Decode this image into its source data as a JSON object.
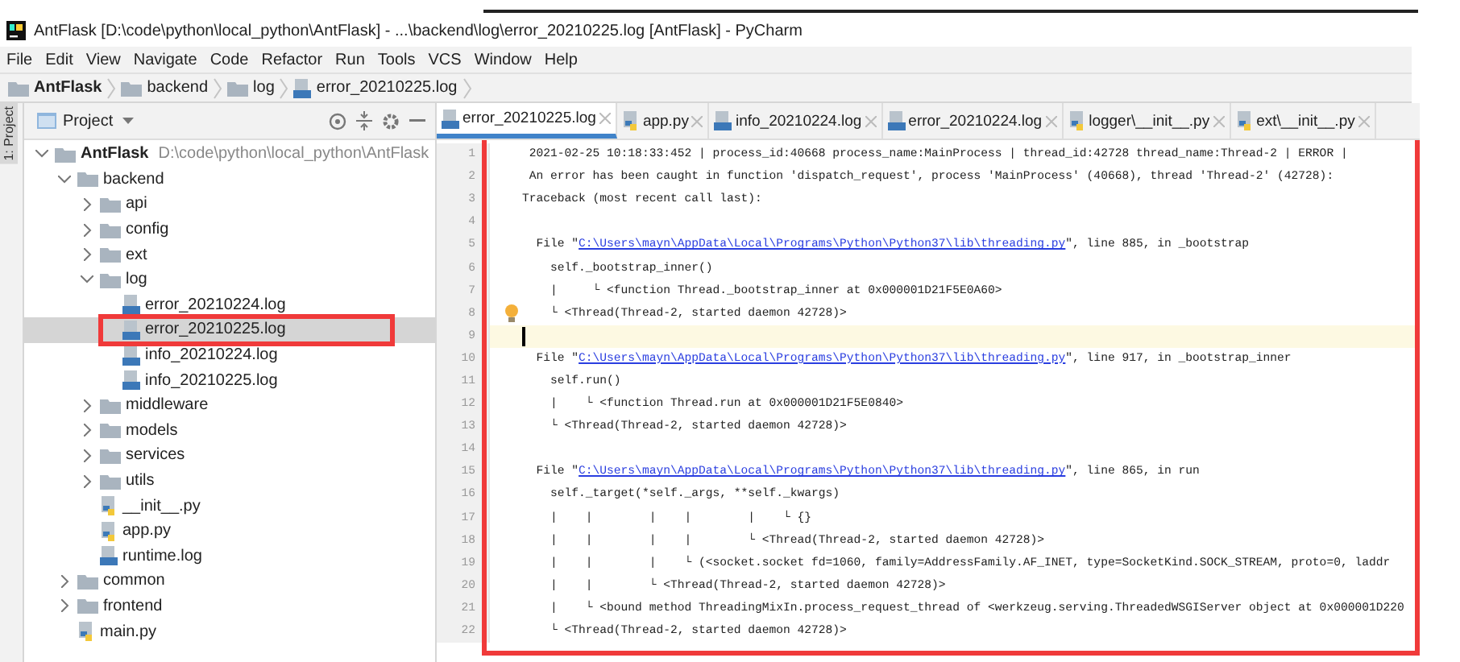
{
  "window": {
    "title": "AntFlask [D:\\code\\python\\local_python\\AntFlask] - ...\\backend\\log\\error_20210225.log [AntFlask] - PyCharm"
  },
  "menu": [
    "File",
    "Edit",
    "View",
    "Navigate",
    "Code",
    "Refactor",
    "Run",
    "Tools",
    "VCS",
    "Window",
    "Help"
  ],
  "breadcrumb": [
    {
      "label": "AntFlask",
      "kind": "folder"
    },
    {
      "label": "backend",
      "kind": "folder"
    },
    {
      "label": "log",
      "kind": "folder"
    },
    {
      "label": "error_20210225.log",
      "kind": "log"
    }
  ],
  "side_strip": {
    "label": "1: Project"
  },
  "project_panel": {
    "title": "Project",
    "tree": [
      {
        "label": "AntFlask",
        "path": "D:\\code\\python\\local_python\\AntFlask",
        "kind": "folder",
        "expanded": true,
        "selected": false,
        "children": [
          {
            "label": "backend",
            "kind": "folder",
            "expanded": true,
            "selected": false,
            "children": [
              {
                "label": "api",
                "kind": "folder",
                "expanded": false,
                "selected": false
              },
              {
                "label": "config",
                "kind": "folder",
                "expanded": false,
                "selected": false
              },
              {
                "label": "ext",
                "kind": "folder",
                "expanded": false,
                "selected": false
              },
              {
                "label": "log",
                "kind": "folder",
                "expanded": true,
                "selected": false,
                "children": [
                  {
                    "label": "error_20210224.log",
                    "kind": "log",
                    "selected": false
                  },
                  {
                    "label": "error_20210225.log",
                    "kind": "log",
                    "selected": true,
                    "highlighted": true
                  },
                  {
                    "label": "info_20210224.log",
                    "kind": "log",
                    "selected": false
                  },
                  {
                    "label": "info_20210225.log",
                    "kind": "log",
                    "selected": false
                  }
                ]
              },
              {
                "label": "middleware",
                "kind": "folder",
                "expanded": false,
                "selected": false
              },
              {
                "label": "models",
                "kind": "folder",
                "expanded": false,
                "selected": false
              },
              {
                "label": "services",
                "kind": "folder",
                "expanded": false,
                "selected": false
              },
              {
                "label": "utils",
                "kind": "folder",
                "expanded": false,
                "selected": false
              },
              {
                "label": "__init__.py",
                "kind": "py",
                "selected": false
              },
              {
                "label": "app.py",
                "kind": "py",
                "selected": false
              },
              {
                "label": "runtime.log",
                "kind": "log",
                "selected": false
              }
            ]
          },
          {
            "label": "common",
            "kind": "folder",
            "expanded": false,
            "selected": false
          },
          {
            "label": "frontend",
            "kind": "folder",
            "expanded": false,
            "selected": false
          },
          {
            "label": "main.py",
            "kind": "py",
            "selected": false
          }
        ]
      }
    ]
  },
  "tabs": [
    {
      "label": "error_20210225.log",
      "kind": "log",
      "selected": true
    },
    {
      "label": "app.py",
      "kind": "py",
      "selected": false
    },
    {
      "label": "info_20210224.log",
      "kind": "log",
      "selected": false
    },
    {
      "label": "error_20210224.log",
      "kind": "log",
      "selected": false
    },
    {
      "label": "logger\\__init__.py",
      "kind": "py",
      "selected": false
    },
    {
      "label": "ext\\__init__.py",
      "kind": "py",
      "selected": false
    }
  ],
  "editor": {
    "highlighted": true,
    "lines": [
      {
        "number": "1",
        "text": " 2021-02-25 10:18:33:452 | process_id:40668 process_name:MainProcess | thread_id:42728 thread_name:Thread-2 | ERROR |"
      },
      {
        "number": "2",
        "text": " An error has been caught in function 'dispatch_request', process 'MainProcess' (40668), thread 'Thread-2' (42728):"
      },
      {
        "number": "3",
        "text": "Traceback (most recent call last):"
      },
      {
        "number": "4"
      },
      {
        "number": "5",
        "text": "  File \"",
        "link": "C:\\Users\\mayn\\AppData\\Local\\Programs\\Python\\Python37\\lib\\threading.py",
        "after": "\", line 885, in _bootstrap"
      },
      {
        "number": "6",
        "text": "    self._bootstrap_inner()"
      },
      {
        "number": "7",
        "text": "    |     └ <function Thread._bootstrap_inner at 0x000001D21F5E0A60>"
      },
      {
        "number": "8",
        "text": "    └ <Thread(Thread-2, started daemon 42728)>",
        "bulb": true
      },
      {
        "number": "9",
        "current": true
      },
      {
        "number": "10",
        "text": "  File \"",
        "link": "C:\\Users\\mayn\\AppData\\Local\\Programs\\Python\\Python37\\lib\\threading.py",
        "after": "\", line 917, in _bootstrap_inner"
      },
      {
        "number": "11",
        "text": "    self.run()"
      },
      {
        "number": "12",
        "text": "    |    └ <function Thread.run at 0x000001D21F5E0840>"
      },
      {
        "number": "13",
        "text": "    └ <Thread(Thread-2, started daemon 42728)>"
      },
      {
        "number": "14"
      },
      {
        "number": "15",
        "text": "  File \"",
        "link": "C:\\Users\\mayn\\AppData\\Local\\Programs\\Python\\Python37\\lib\\threading.py",
        "after": "\", line 865, in run"
      },
      {
        "number": "16",
        "text": "    self._target(*self._args, **self._kwargs)"
      },
      {
        "number": "17",
        "text": "    |    |        |    |        |    └ {}"
      },
      {
        "number": "18",
        "text": "    |    |        |    |        └ <Thread(Thread-2, started daemon 42728)>"
      },
      {
        "number": "19",
        "text": "    |    |        |    └ (<socket.socket fd=1060, family=AddressFamily.AF_INET, type=SocketKind.SOCK_STREAM, proto=0, laddr"
      },
      {
        "number": "20",
        "text": "    |    |        └ <Thread(Thread-2, started daemon 42728)>"
      },
      {
        "number": "21",
        "text": "    |    └ <bound method ThreadingMixIn.process_request_thread of <werkzeug.serving.ThreadedWSGIServer object at 0x000001D220"
      },
      {
        "number": "22",
        "text": "    └ <Thread(Thread-2, started daemon 42728)>"
      }
    ]
  }
}
